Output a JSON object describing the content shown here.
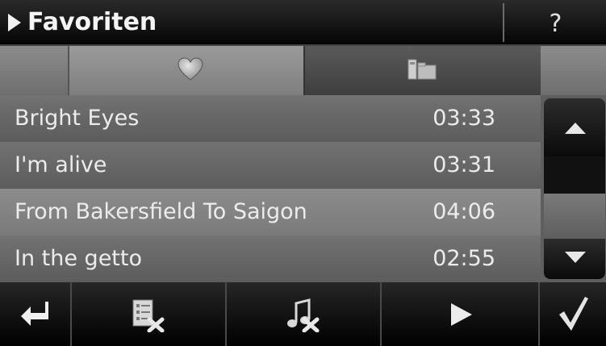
{
  "header": {
    "title": "Favoriten",
    "help_label": "?"
  },
  "tabs": [
    {
      "icon": "heart-icon",
      "active": true
    },
    {
      "icon": "folder-icon",
      "active": false
    }
  ],
  "tracks": [
    {
      "title": "Bright Eyes",
      "duration": "03:33",
      "selected": false
    },
    {
      "title": "I'm alive",
      "duration": "03:31",
      "selected": false
    },
    {
      "title": "From Bakersfield To Saigon",
      "duration": "04:06",
      "selected": true
    },
    {
      "title": "In the getto",
      "duration": "02:55",
      "selected": false
    }
  ],
  "scrollbar": {
    "up_icon": "arrow-up-icon",
    "down_icon": "arrow-down-icon"
  },
  "toolbar": {
    "buttons": [
      {
        "icon": "back-arrow-icon"
      },
      {
        "icon": "delete-list-icon"
      },
      {
        "icon": "delete-track-icon"
      },
      {
        "icon": "play-icon"
      },
      {
        "icon": "confirm-check-icon"
      }
    ]
  }
}
